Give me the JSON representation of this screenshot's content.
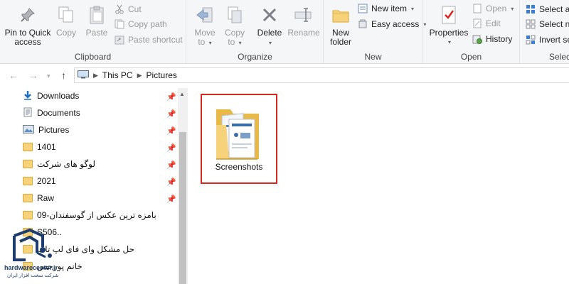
{
  "ribbon": {
    "clipboard": {
      "group_label": "Clipboard",
      "pin_label_1": "Pin to Quick",
      "pin_label_2": "access",
      "copy_label": "Copy",
      "paste_label": "Paste",
      "cut_label": "Cut",
      "copy_path_label": "Copy path",
      "paste_shortcut_label": "Paste shortcut"
    },
    "organize": {
      "group_label": "Organize",
      "move_to_label_1": "Move",
      "move_to_label_2": "to",
      "copy_to_label_1": "Copy",
      "copy_to_label_2": "to",
      "delete_label": "Delete",
      "rename_label": "Rename"
    },
    "new": {
      "group_label": "New",
      "new_folder_label_1": "New",
      "new_folder_label_2": "folder",
      "new_item_label": "New item",
      "easy_access_label": "Easy access"
    },
    "open": {
      "group_label": "Open",
      "properties_label": "Properties",
      "open_label": "Open",
      "edit_label": "Edit",
      "history_label": "History"
    },
    "select": {
      "group_label": "Selec",
      "select_all_label": "Select al",
      "select_none_label": "Select no",
      "invert_selection_label": "Invert se"
    }
  },
  "address_bar": {
    "crumbs": [
      "This PC",
      "Pictures"
    ]
  },
  "navigation_pane": {
    "items": [
      {
        "label": "Downloads",
        "icon": "download-arrow-icon",
        "pinned": true
      },
      {
        "label": "Documents",
        "icon": "documents-icon",
        "pinned": true
      },
      {
        "label": "Pictures",
        "icon": "pictures-icon",
        "pinned": true
      },
      {
        "label": "1401",
        "icon": "folder-icon",
        "pinned": true
      },
      {
        "label": "لوگو های شرکت",
        "icon": "folder-icon",
        "pinned": true
      },
      {
        "label": "2021",
        "icon": "folder-icon",
        "pinned": true
      },
      {
        "label": "Raw",
        "icon": "folder-icon",
        "pinned": true
      },
      {
        "label": "بامزه ترین عکس از گوسفندان-09",
        "icon": "folder-icon",
        "pinned": false
      },
      {
        "label": "S506..",
        "icon": "folder-icon",
        "pinned": false
      },
      {
        "label": "حل مشکل وای فای لپ تاپ",
        "icon": "folder-icon",
        "pinned": false
      },
      {
        "label": "خانم پورحس",
        "icon": "folder-icon",
        "pinned": false
      }
    ]
  },
  "content": {
    "folder_tile": {
      "label": "Screenshots"
    }
  },
  "watermark": {
    "line1": "hardwarecenter.ir",
    "line2": "شرکت سخت افزار ایران"
  },
  "colors": {
    "selection_border": "#d8261d",
    "ribbon_bg": "#f5f6f7",
    "folder_yellow": "#f6d27a",
    "accent_blue": "#1f6fc4"
  }
}
